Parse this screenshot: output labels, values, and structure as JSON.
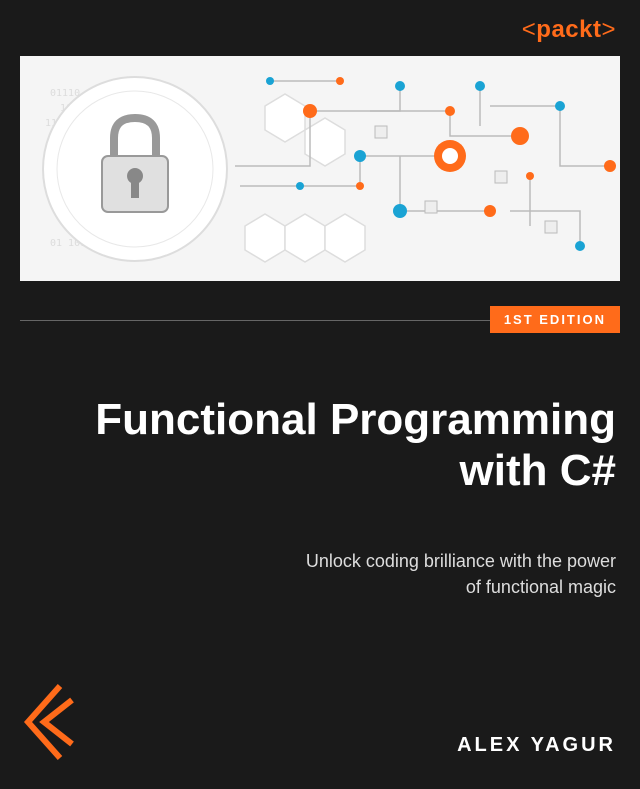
{
  "publisher": "packt",
  "edition_badge": "1ST EDITION",
  "title_line1": "Functional Programming",
  "title_line2": "with C#",
  "subtitle_line1": "Unlock coding brilliance with the power",
  "subtitle_line2": "of functional magic",
  "author": "ALEX YAGUR",
  "colors": {
    "accent": "#ff6b1a",
    "background": "#1a1a1a",
    "text": "#ffffff"
  }
}
